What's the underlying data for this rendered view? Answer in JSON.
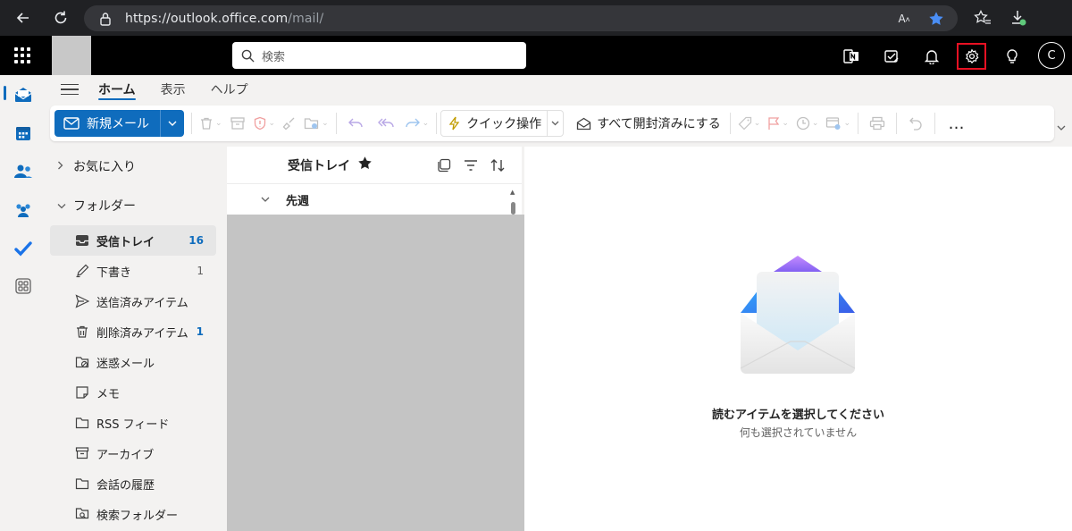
{
  "browser": {
    "url_host": "https://outlook.office.com",
    "url_path": "/mail/"
  },
  "header": {
    "search_placeholder": "検索",
    "avatar_initial": "C"
  },
  "ribbon": {
    "tabs": [
      {
        "label": "ホーム",
        "active": true
      },
      {
        "label": "表示",
        "active": false
      },
      {
        "label": "ヘルプ",
        "active": false
      }
    ],
    "new_mail_label": "新規メール",
    "quick_steps_label": "クイック操作",
    "mark_all_read_label": "すべて開封済みにする",
    "more_label": "…"
  },
  "folders": {
    "favorites_label": "お気に入り",
    "folders_label": "フォルダー",
    "items": [
      {
        "label": "受信トレイ",
        "count": "16",
        "icon": "inbox-icon",
        "selected": true
      },
      {
        "label": "下書き",
        "count": "1",
        "icon": "draft-icon"
      },
      {
        "label": "送信済みアイテム",
        "count": "",
        "icon": "sent-icon"
      },
      {
        "label": "削除済みアイテム",
        "count": "1",
        "icon": "trash-icon"
      },
      {
        "label": "迷惑メール",
        "count": "",
        "icon": "junk-icon"
      },
      {
        "label": "メモ",
        "count": "",
        "icon": "note-icon"
      },
      {
        "label": "RSS フィード",
        "count": "",
        "icon": "rss-folder-icon"
      },
      {
        "label": "アーカイブ",
        "count": "",
        "icon": "archive-icon"
      },
      {
        "label": "会話の履歴",
        "count": "",
        "icon": "folder-icon"
      },
      {
        "label": "検索フォルダー",
        "count": "",
        "icon": "search-folder-icon"
      }
    ]
  },
  "message_list": {
    "title": "受信トレイ",
    "group_label": "先週"
  },
  "reading_pane": {
    "empty_title": "読むアイテムを選択してください",
    "empty_subtitle": "何も選択されていません"
  },
  "colors": {
    "accent": "#0f6cbd",
    "settings_highlight": "#e81123"
  }
}
